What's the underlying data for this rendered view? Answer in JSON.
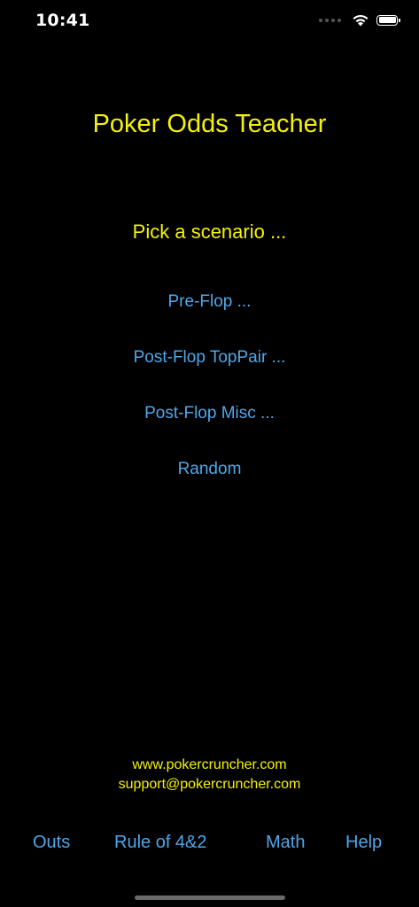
{
  "status_bar": {
    "time": "10:41"
  },
  "app": {
    "title": "Poker Odds Teacher"
  },
  "main": {
    "prompt": "Pick a scenario ...",
    "scenarios": [
      {
        "label": "Pre-Flop ..."
      },
      {
        "label": "Post-Flop TopPair ..."
      },
      {
        "label": "Post-Flop Misc ..."
      },
      {
        "label": "Random"
      }
    ]
  },
  "contact": {
    "website": "www.pokercruncher.com",
    "email": "support@pokercruncher.com"
  },
  "toolbar": {
    "outs_label": "Outs",
    "rule_label": "Rule of 4&2",
    "math_label": "Math",
    "help_label": "Help"
  },
  "colors": {
    "background": "#000000",
    "title_yellow": "#f5f10a",
    "link_blue": "#4ea7ea"
  },
  "icons": {
    "status": [
      "cellular-signal-icon",
      "wifi-icon",
      "battery-icon"
    ]
  }
}
